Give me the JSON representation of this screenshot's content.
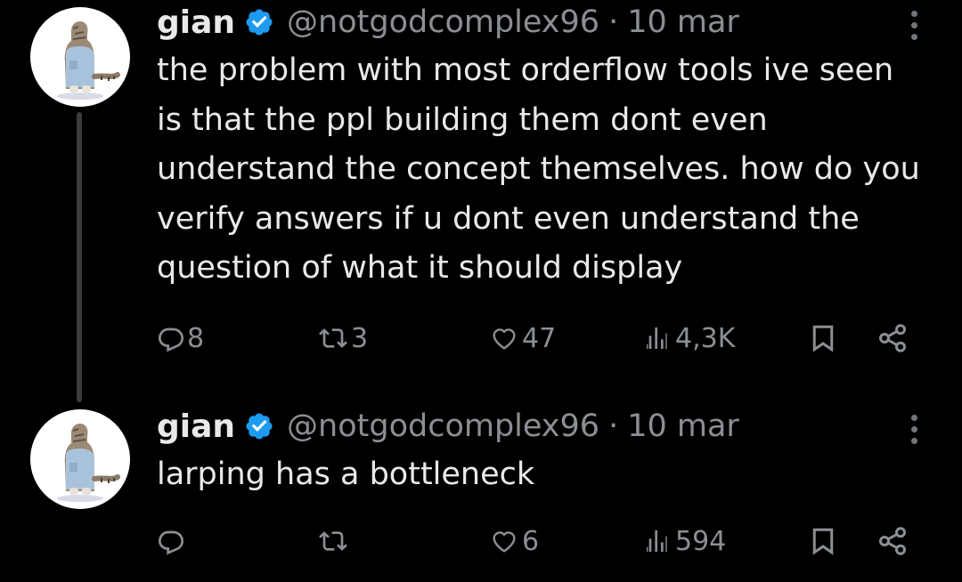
{
  "tweets": [
    {
      "display_name": "gian",
      "handle": "@notgodcomplex96",
      "separator": "·",
      "date": "10 mar",
      "text": "the problem with most orderflow tools ive seen is that the ppl building them dont even understand the concept themselves. how do you verify answers if u dont even understand the question of what it should display",
      "replies": "8",
      "reposts": "3",
      "likes": "47",
      "views": "4,3K"
    },
    {
      "display_name": "gian",
      "handle": "@notgodcomplex96",
      "separator": "·",
      "date": "10 mar",
      "text": "larping has a bottleneck",
      "replies": "",
      "reposts": "",
      "likes": "6",
      "views": "594"
    }
  ],
  "icons": {
    "verified": "verified-badge-icon",
    "more": "more-options-icon",
    "reply": "reply-icon",
    "repost": "repost-icon",
    "like": "heart-icon",
    "views": "views-bar-chart-icon",
    "bookmark": "bookmark-icon",
    "share": "share-icon"
  },
  "colors": {
    "background": "#000000",
    "text": "#e7e9ea",
    "muted": "#8b8f94",
    "verified": "#1d9bf0",
    "thread_line": "#3a3b3d"
  }
}
